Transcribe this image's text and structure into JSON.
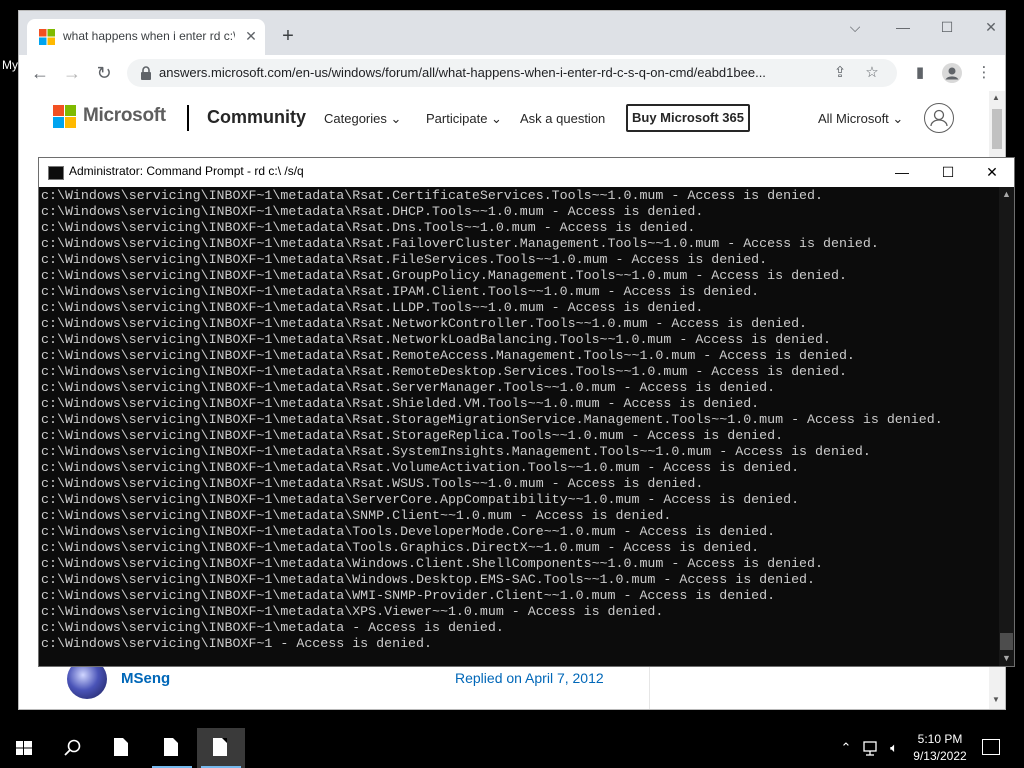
{
  "desktop": {
    "partial_label": "My"
  },
  "browser": {
    "tab_title": "what happens when i enter rd c:\\",
    "url": "answers.microsoft.com/en-us/windows/forum/all/what-happens-when-i-enter-rd-c-s-q-on-cmd/eabd1bee...",
    "icons": [
      "back-icon",
      "forward-icon",
      "reload-icon",
      "lock-icon",
      "share-icon",
      "bookmark-star-icon",
      "sidebar-icon",
      "profile-icon",
      "menu-icon"
    ]
  },
  "page": {
    "brand": "Microsoft",
    "section": "Community",
    "nav": [
      "Categories",
      "Participate",
      "Ask a question"
    ],
    "buy_button": "Buy Microsoft 365",
    "all_microsoft": "All Microsoft",
    "reply": {
      "author": "MSeng",
      "date": "Replied on April 7, 2012"
    }
  },
  "cmd": {
    "title": "Administrator: Command Prompt - rd  c:\\ /s/q",
    "lines": [
      "c:\\Windows\\servicing\\INBOXF~1\\metadata\\Rsat.CertificateServices.Tools~~1.0.mum - Access is denied.",
      "c:\\Windows\\servicing\\INBOXF~1\\metadata\\Rsat.DHCP.Tools~~1.0.mum - Access is denied.",
      "c:\\Windows\\servicing\\INBOXF~1\\metadata\\Rsat.Dns.Tools~~1.0.mum - Access is denied.",
      "c:\\Windows\\servicing\\INBOXF~1\\metadata\\Rsat.FailoverCluster.Management.Tools~~1.0.mum - Access is denied.",
      "c:\\Windows\\servicing\\INBOXF~1\\metadata\\Rsat.FileServices.Tools~~1.0.mum - Access is denied.",
      "c:\\Windows\\servicing\\INBOXF~1\\metadata\\Rsat.GroupPolicy.Management.Tools~~1.0.mum - Access is denied.",
      "c:\\Windows\\servicing\\INBOXF~1\\metadata\\Rsat.IPAM.Client.Tools~~1.0.mum - Access is denied.",
      "c:\\Windows\\servicing\\INBOXF~1\\metadata\\Rsat.LLDP.Tools~~1.0.mum - Access is denied.",
      "c:\\Windows\\servicing\\INBOXF~1\\metadata\\Rsat.NetworkController.Tools~~1.0.mum - Access is denied.",
      "c:\\Windows\\servicing\\INBOXF~1\\metadata\\Rsat.NetworkLoadBalancing.Tools~~1.0.mum - Access is denied.",
      "c:\\Windows\\servicing\\INBOXF~1\\metadata\\Rsat.RemoteAccess.Management.Tools~~1.0.mum - Access is denied.",
      "c:\\Windows\\servicing\\INBOXF~1\\metadata\\Rsat.RemoteDesktop.Services.Tools~~1.0.mum - Access is denied.",
      "c:\\Windows\\servicing\\INBOXF~1\\metadata\\Rsat.ServerManager.Tools~~1.0.mum - Access is denied.",
      "c:\\Windows\\servicing\\INBOXF~1\\metadata\\Rsat.Shielded.VM.Tools~~1.0.mum - Access is denied.",
      "c:\\Windows\\servicing\\INBOXF~1\\metadata\\Rsat.StorageMigrationService.Management.Tools~~1.0.mum - Access is denied.",
      "c:\\Windows\\servicing\\INBOXF~1\\metadata\\Rsat.StorageReplica.Tools~~1.0.mum - Access is denied.",
      "c:\\Windows\\servicing\\INBOXF~1\\metadata\\Rsat.SystemInsights.Management.Tools~~1.0.mum - Access is denied.",
      "c:\\Windows\\servicing\\INBOXF~1\\metadata\\Rsat.VolumeActivation.Tools~~1.0.mum - Access is denied.",
      "c:\\Windows\\servicing\\INBOXF~1\\metadata\\Rsat.WSUS.Tools~~1.0.mum - Access is denied.",
      "c:\\Windows\\servicing\\INBOXF~1\\metadata\\ServerCore.AppCompatibility~~1.0.mum - Access is denied.",
      "c:\\Windows\\servicing\\INBOXF~1\\metadata\\SNMP.Client~~1.0.mum - Access is denied.",
      "c:\\Windows\\servicing\\INBOXF~1\\metadata\\Tools.DeveloperMode.Core~~1.0.mum - Access is denied.",
      "c:\\Windows\\servicing\\INBOXF~1\\metadata\\Tools.Graphics.DirectX~~1.0.mum - Access is denied.",
      "c:\\Windows\\servicing\\INBOXF~1\\metadata\\Windows.Client.ShellComponents~~1.0.mum - Access is denied.",
      "c:\\Windows\\servicing\\INBOXF~1\\metadata\\Windows.Desktop.EMS-SAC.Tools~~1.0.mum - Access is denied.",
      "c:\\Windows\\servicing\\INBOXF~1\\metadata\\WMI-SNMP-Provider.Client~~1.0.mum - Access is denied.",
      "c:\\Windows\\servicing\\INBOXF~1\\metadata\\XPS.Viewer~~1.0.mum - Access is denied.",
      "c:\\Windows\\servicing\\INBOXF~1\\metadata - Access is denied.",
      "c:\\Windows\\servicing\\INBOXF~1 - Access is denied."
    ]
  },
  "taskbar": {
    "time": "5:10 PM",
    "date": "9/13/2022",
    "icons": [
      "start-icon",
      "search-icon",
      "document-icon",
      "document-icon",
      "document-icon",
      "chevron-up-icon",
      "network-icon",
      "volume-icon",
      "notification-icon"
    ]
  },
  "colors": {
    "console_bg": "#0c0c0c",
    "console_fg": "#cccccc",
    "ms_red": "#f25022",
    "ms_green": "#7fba00",
    "ms_blue": "#00a4ef",
    "ms_yellow": "#ffb900",
    "link": "#0067b8"
  }
}
